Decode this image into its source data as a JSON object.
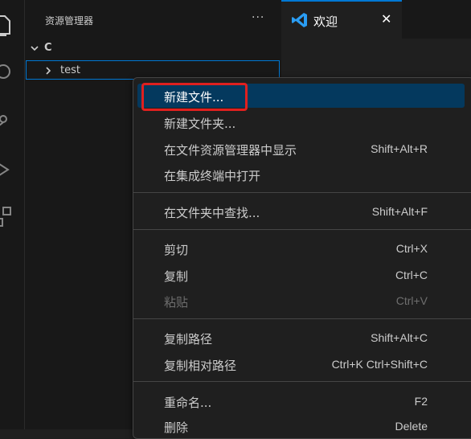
{
  "explorer": {
    "title": "资源管理器",
    "more": "···",
    "folder": "C",
    "tree_item": "test"
  },
  "tab": {
    "label": "欢迎",
    "close": "✕",
    "accent": "#0078d4"
  },
  "context_menu": {
    "groups": [
      [
        {
          "label": "新建文件...",
          "key": ""
        },
        {
          "label": "新建文件夹...",
          "key": ""
        },
        {
          "label": "在文件资源管理器中显示",
          "key": "Shift+Alt+R"
        },
        {
          "label": "在集成终端中打开",
          "key": ""
        }
      ],
      [
        {
          "label": "在文件夹中查找...",
          "key": "Shift+Alt+F"
        }
      ],
      [
        {
          "label": "剪切",
          "key": "Ctrl+X"
        },
        {
          "label": "复制",
          "key": "Ctrl+C"
        },
        {
          "label": "粘贴",
          "key": "Ctrl+V"
        }
      ],
      [
        {
          "label": "复制路径",
          "key": "Shift+Alt+C"
        },
        {
          "label": "复制相对路径",
          "key": "Ctrl+K Ctrl+Shift+C"
        }
      ],
      [
        {
          "label": "重命名...",
          "key": "F2"
        },
        {
          "label": "删除",
          "key": "Delete"
        }
      ]
    ],
    "highlight_color": "#e0201f"
  }
}
